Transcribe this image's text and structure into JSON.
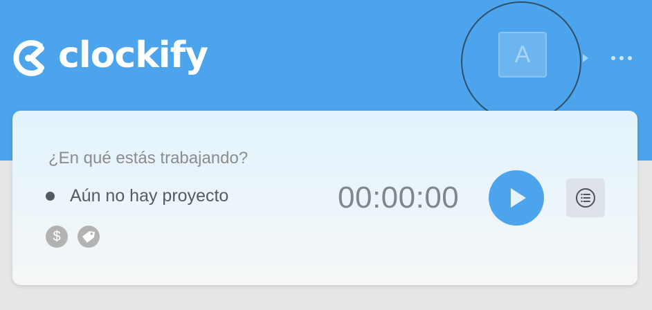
{
  "header": {
    "logo_text": "clockify",
    "avatar_initial": "A",
    "menu_icon": "more-dots-icon",
    "caret_icon": "caret-right-icon"
  },
  "tracker": {
    "task_placeholder": "¿En qué estás trabajando?",
    "task_value": "",
    "project_label": "Aún no hay proyecto",
    "billable_symbol": "$",
    "billable_icon": "dollar-icon",
    "tag_icon": "tag-icon",
    "timer": "00:00:00",
    "start_icon": "play-icon",
    "mode_icon": "list-icon"
  },
  "colors": {
    "header_bg": "#4ba4ec",
    "primary": "#4ba4ec",
    "page_bg": "#e6e6e6",
    "timer_text": "#7f868c",
    "muted_icon": "#b3b3b3"
  }
}
